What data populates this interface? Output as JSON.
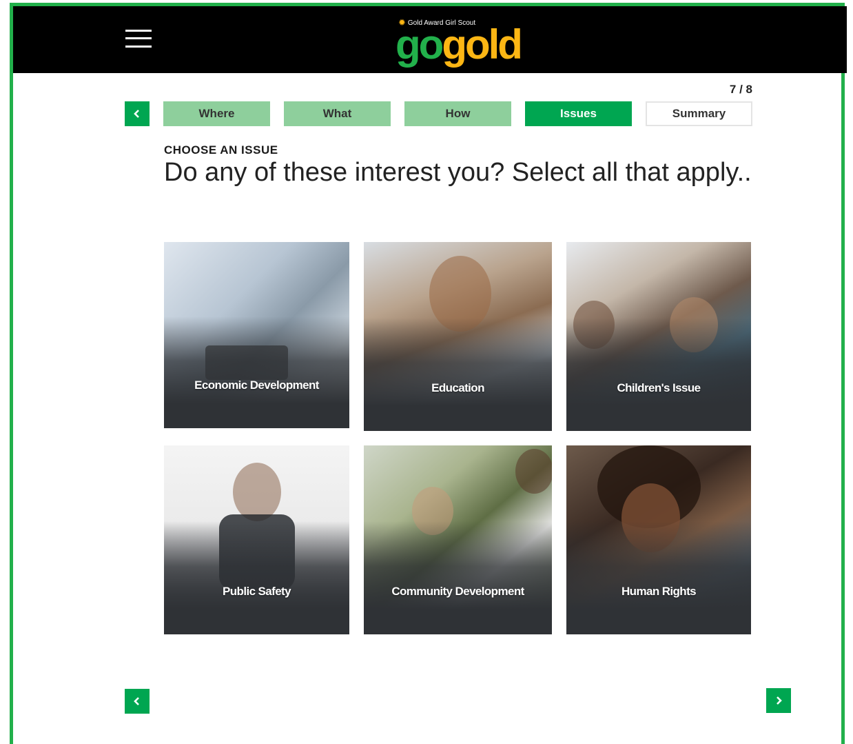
{
  "header": {
    "logo_tagline": "Gold Award Girl Scout",
    "logo_go": "go",
    "logo_gold": "gold"
  },
  "progress": {
    "step_label": "7 / 8"
  },
  "tabs": [
    {
      "label": "Where",
      "state": "done"
    },
    {
      "label": "What",
      "state": "done"
    },
    {
      "label": "How",
      "state": "done"
    },
    {
      "label": "Issues",
      "state": "active"
    },
    {
      "label": "Summary",
      "state": "todo"
    }
  ],
  "section": {
    "eyebrow": "CHOOSE AN ISSUE",
    "question": "Do any of these interest you? Select all that apply.."
  },
  "issues": [
    {
      "label": "Economic Development"
    },
    {
      "label": "Education"
    },
    {
      "label": "Children's Issue"
    },
    {
      "label": "Public Safety"
    },
    {
      "label": "Community Development"
    },
    {
      "label": "Human Rights"
    }
  ],
  "icons": {
    "menu": "hamburger-menu-icon",
    "prev": "chevron-left-icon",
    "next": "chevron-right-icon",
    "logo_mark": "sun-icon"
  },
  "colors": {
    "brand_green": "#00a651",
    "tab_done": "#8ecf9c",
    "gold": "#fcb614",
    "header_bg": "#000000",
    "frame": "#22b04b"
  }
}
